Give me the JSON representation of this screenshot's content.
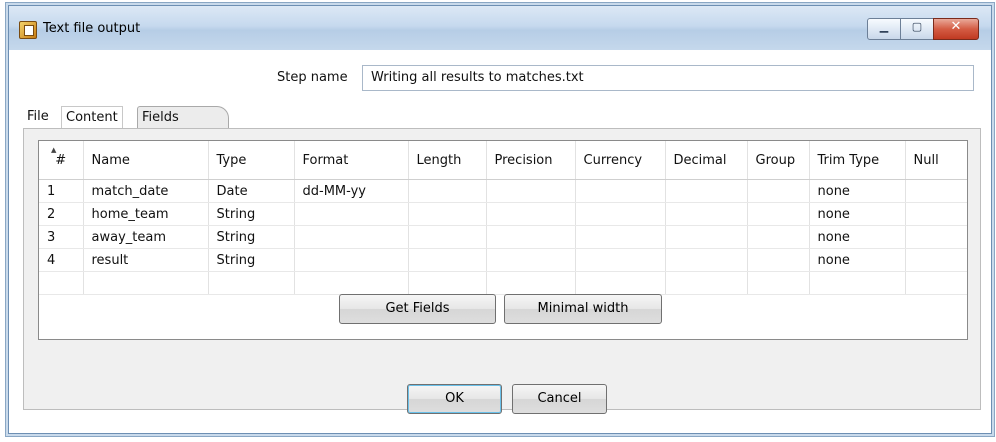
{
  "window": {
    "title": "Text file output"
  },
  "step": {
    "label": "Step name",
    "value": "Writing all results to matches.txt"
  },
  "tabs": [
    {
      "label": "File"
    },
    {
      "label": "Content"
    },
    {
      "label": "Fields",
      "active": true
    }
  ],
  "table": {
    "columns": [
      "#",
      "Name",
      "Type",
      "Format",
      "Length",
      "Precision",
      "Currency",
      "Decimal",
      "Group",
      "Trim Type",
      "Null"
    ],
    "rows": [
      {
        "n": "1",
        "name": "match_date",
        "type": "Date",
        "format": "dd-MM-yy",
        "length": "",
        "precision": "",
        "currency": "",
        "decimal": "",
        "group": "",
        "trim": "none",
        "null": ""
      },
      {
        "n": "2",
        "name": "home_team",
        "type": "String",
        "format": "",
        "length": "",
        "precision": "",
        "currency": "",
        "decimal": "",
        "group": "",
        "trim": "none",
        "null": ""
      },
      {
        "n": "3",
        "name": "away_team",
        "type": "String",
        "format": "",
        "length": "",
        "precision": "",
        "currency": "",
        "decimal": "",
        "group": "",
        "trim": "none",
        "null": ""
      },
      {
        "n": "4",
        "name": "result",
        "type": "String",
        "format": "",
        "length": "",
        "precision": "",
        "currency": "",
        "decimal": "",
        "group": "",
        "trim": "none",
        "null": ""
      }
    ]
  },
  "buttons": {
    "get_fields": "Get Fields",
    "minimal_width": "Minimal width",
    "ok": "OK",
    "cancel": "Cancel"
  },
  "icons": {
    "app": "text-file-output-icon",
    "minimize": "minimize-icon",
    "maximize": "maximize-icon",
    "close": "close-icon"
  }
}
